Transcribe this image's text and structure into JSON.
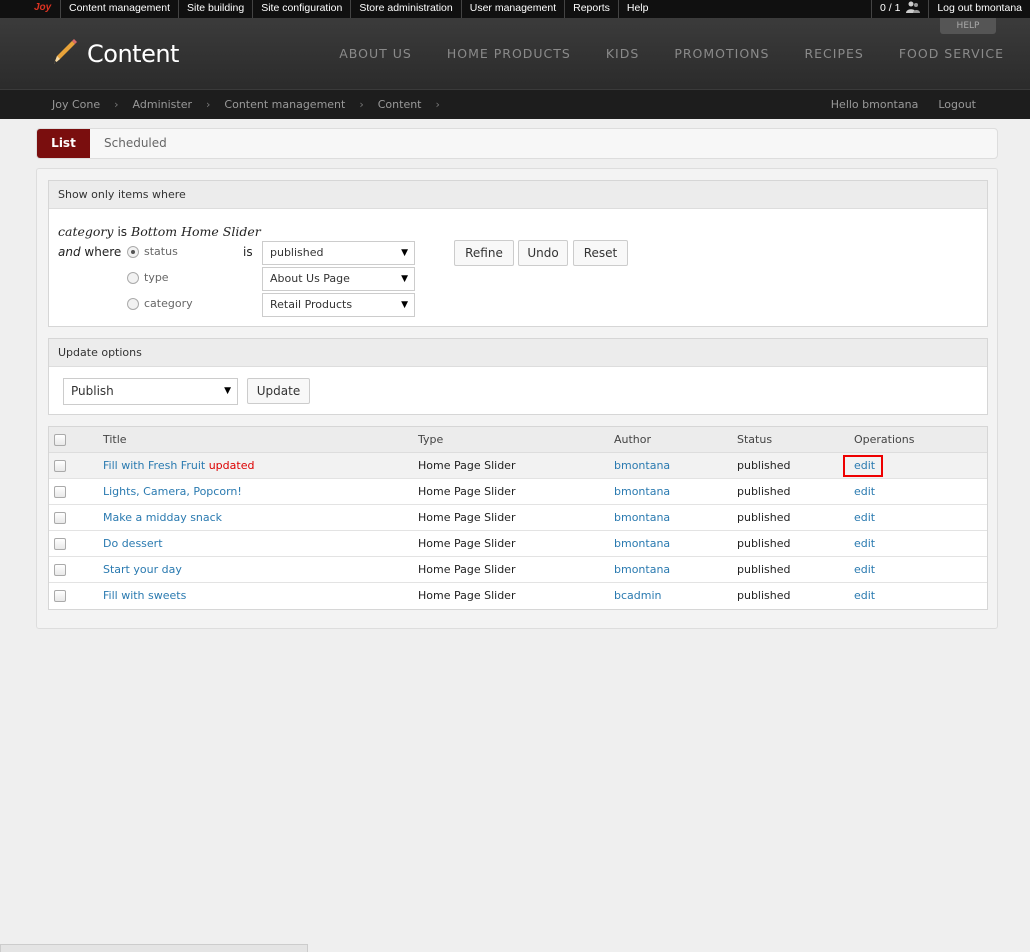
{
  "admin_bar": {
    "logo": "Joy",
    "menu": [
      "Content management",
      "Site building",
      "Site configuration",
      "Store administration",
      "User management",
      "Reports",
      "Help"
    ],
    "user_count": "0 / 1",
    "logout": "Log out bmontana"
  },
  "header": {
    "help": "HELP",
    "title": "Content",
    "nav": [
      "ABOUT US",
      "HOME PRODUCTS",
      "KIDS",
      "PROMOTIONS",
      "RECIPES",
      "FOOD SERVICE"
    ]
  },
  "breadcrumb": [
    "Joy Cone",
    "Administer",
    "Content management",
    "Content"
  ],
  "user_links": {
    "hello": "Hello bmontana",
    "logout": "Logout"
  },
  "tabs": {
    "list": "List",
    "scheduled": "Scheduled"
  },
  "filter": {
    "legend": "Show only items where",
    "current_field": "category",
    "current_is": "is",
    "current_value": "Bottom Home Slider",
    "and": "and",
    "where": "where",
    "is": "is",
    "radios": [
      {
        "label": "status",
        "checked": true
      },
      {
        "label": "type",
        "checked": false
      },
      {
        "label": "category",
        "checked": false
      }
    ],
    "selects": [
      "published",
      "About Us Page",
      "Retail Products"
    ],
    "buttons": {
      "refine": "Refine",
      "undo": "Undo",
      "reset": "Reset"
    }
  },
  "update_options": {
    "legend": "Update options",
    "select": "Publish",
    "button": "Update"
  },
  "table": {
    "headers": {
      "title": "Title",
      "type": "Type",
      "author": "Author",
      "status": "Status",
      "operations": "Operations"
    },
    "rows": [
      {
        "title": "Fill with Fresh Fruit",
        "flag": "updated",
        "type": "Home Page Slider",
        "author": "bmontana",
        "status": "published",
        "op": "edit"
      },
      {
        "title": "Lights, Camera, Popcorn!",
        "flag": "",
        "type": "Home Page Slider",
        "author": "bmontana",
        "status": "published",
        "op": "edit"
      },
      {
        "title": "Make a midday snack",
        "flag": "",
        "type": "Home Page Slider",
        "author": "bmontana",
        "status": "published",
        "op": "edit"
      },
      {
        "title": "Do dessert",
        "flag": "",
        "type": "Home Page Slider",
        "author": "bmontana",
        "status": "published",
        "op": "edit"
      },
      {
        "title": "Start your day",
        "flag": "",
        "type": "Home Page Slider",
        "author": "bmontana",
        "status": "published",
        "op": "edit"
      },
      {
        "title": "Fill with sweets",
        "flag": "",
        "type": "Home Page Slider",
        "author": "bcadmin",
        "status": "published",
        "op": "edit"
      }
    ]
  },
  "colors": {
    "accent": "#7a0e0e",
    "link": "#2a7ab0",
    "highlight": "#ee0000"
  },
  "icons": {
    "logo": "joy-logo-icon",
    "users": "users-icon",
    "pencil": "pencil-icon",
    "dropdown": "dropdown-arrow-icon"
  }
}
